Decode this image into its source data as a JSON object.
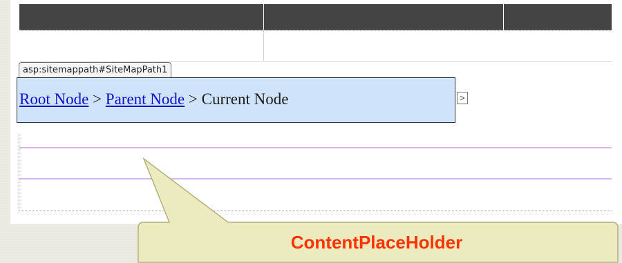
{
  "sitemappath": {
    "tag_label": "asp:sitemappath#SiteMapPath1",
    "root_node": "Root Node",
    "separator1": " > ",
    "parent_node": "Parent Node",
    "separator2": " > ",
    "current_node": "Current Node",
    "smart_tag_glyph": ">"
  },
  "callout": {
    "label": "ContentPlaceHolder"
  },
  "colors": {
    "header_bar": "#444444",
    "sitemap_bg": "#cfe3fb",
    "link": "#1010cc",
    "callout_fill": "#ecebc0",
    "callout_text": "#ff3300",
    "placeholder_border": "#d8b7f0"
  },
  "icons": {
    "smart_tag": "chevron-right-icon"
  }
}
